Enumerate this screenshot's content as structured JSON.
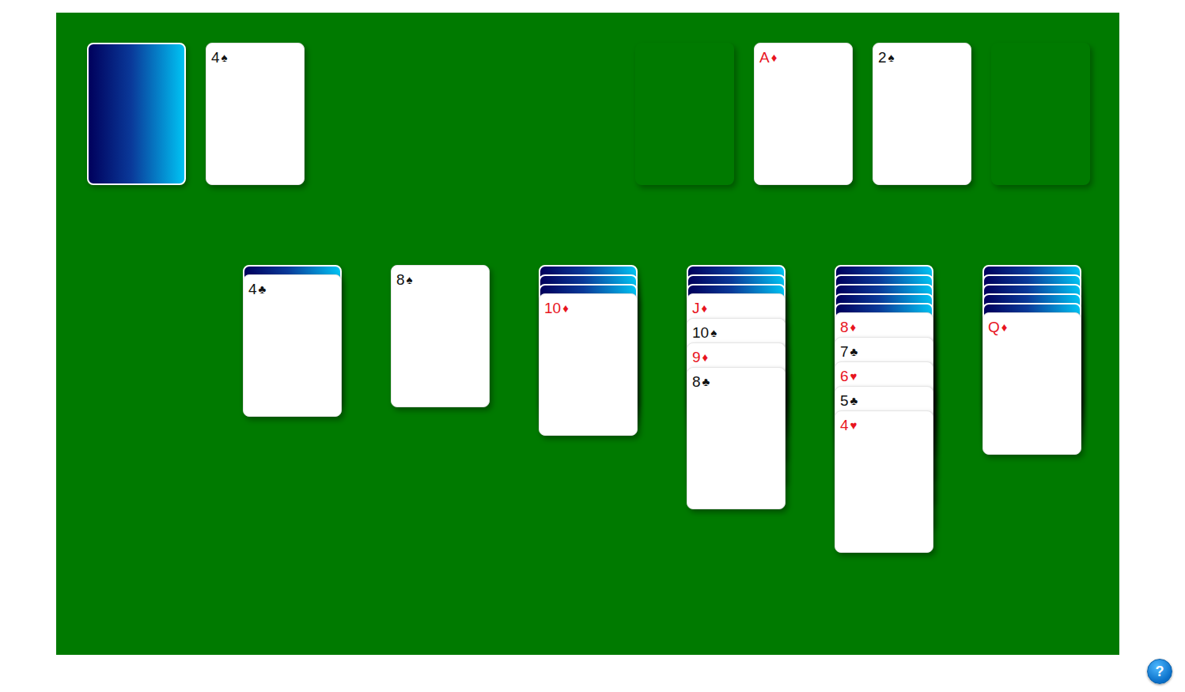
{
  "stock": {
    "has_cards": true
  },
  "waste": {
    "cards": [
      {
        "rank": "4",
        "suit": "♠",
        "color": "#111111"
      }
    ]
  },
  "foundations": [
    {
      "card": null
    },
    {
      "card": {
        "rank": "A",
        "suit": "♦",
        "color": "#e8141e"
      }
    },
    {
      "card": {
        "rank": "2",
        "suit": "♠",
        "color": "#111111"
      }
    },
    {
      "card": null
    }
  ],
  "tableau": [
    {
      "face_down": 0,
      "cards": []
    },
    {
      "face_down": 1,
      "cards": [
        {
          "rank": "4",
          "suit": "♣",
          "color": "#111111"
        }
      ]
    },
    {
      "face_down": 0,
      "cards": [
        {
          "rank": "8",
          "suit": "♠",
          "color": "#111111"
        }
      ]
    },
    {
      "face_down": 3,
      "cards": [
        {
          "rank": "10",
          "suit": "♦",
          "color": "#e8141e"
        }
      ]
    },
    {
      "face_down": 3,
      "cards": [
        {
          "rank": "J",
          "suit": "♦",
          "color": "#e8141e"
        },
        {
          "rank": "10",
          "suit": "♠",
          "color": "#111111"
        },
        {
          "rank": "9",
          "suit": "♦",
          "color": "#e8141e"
        },
        {
          "rank": "8",
          "suit": "♣",
          "color": "#111111"
        }
      ]
    },
    {
      "face_down": 5,
      "cards": [
        {
          "rank": "8",
          "suit": "♦",
          "color": "#e8141e"
        },
        {
          "rank": "7",
          "suit": "♣",
          "color": "#111111"
        },
        {
          "rank": "6",
          "suit": "♥",
          "color": "#e8141e"
        },
        {
          "rank": "5",
          "suit": "♣",
          "color": "#111111"
        },
        {
          "rank": "4",
          "suit": "♥",
          "color": "#e8141e"
        }
      ]
    },
    {
      "face_down": 5,
      "cards": [
        {
          "rank": "Q",
          "suit": "♦",
          "color": "#e8141e"
        }
      ]
    }
  ],
  "help": {
    "label": "?"
  }
}
